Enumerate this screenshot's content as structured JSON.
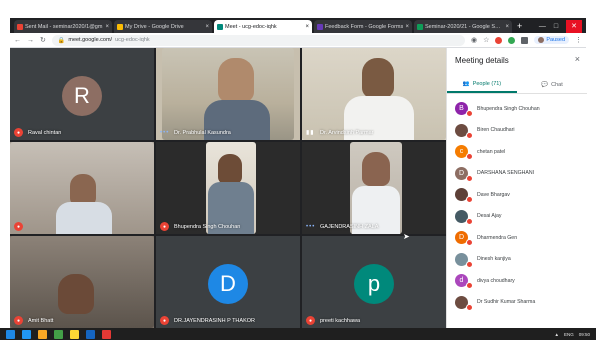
{
  "browser": {
    "tabs": [
      {
        "title": "Sent Mail - seminar2020/1@gm",
        "color": "#ea4335",
        "active": false
      },
      {
        "title": "My Drive - Google Drive",
        "color": "#fbbc04",
        "active": false
      },
      {
        "title": "Meet - ucg-edoc-iqhk",
        "color": "#00897b",
        "active": true
      },
      {
        "title": "Feedback Form - Google Forms",
        "color": "#673ab7",
        "active": false
      },
      {
        "title": "Seminar-2020/21 - Google Sheets",
        "color": "#0f9d58",
        "active": false
      }
    ],
    "new_tab": "+",
    "url_host": "meet.google.com/",
    "url_path": "ucg-edoc-iqhk",
    "profile_label": "Paused"
  },
  "meet": {
    "tiles": [
      {
        "name": "Raval chintan",
        "initial": "R",
        "avatar_color": "#8d6e63",
        "type": "avatar",
        "indicator": "badge"
      },
      {
        "name": "Dr. Prabhulal Kasundra",
        "type": "video",
        "indicator": "dots"
      },
      {
        "name": "Dr. Arvindsinh Parmar",
        "type": "video",
        "indicator": "mic"
      },
      {
        "name": "",
        "type": "video",
        "indicator": "badge"
      },
      {
        "name": "Bhupendra Singh Chouhan",
        "type": "video",
        "indicator": "badge"
      },
      {
        "name": "GAJENDRASINH ZALA",
        "type": "video",
        "indicator": "dots"
      },
      {
        "name": "Amit Bhatt",
        "type": "video",
        "indicator": "badge"
      },
      {
        "name": "DR.JAYENDRASINH P THAKOR",
        "initial": "D",
        "avatar_color": "#1e88e5",
        "type": "avatar",
        "indicator": "badge"
      },
      {
        "name": "preeti kachhawa",
        "initial": "p",
        "avatar_color": "#00897b",
        "type": "avatar",
        "indicator": "badge"
      }
    ]
  },
  "panel": {
    "title": "Meeting details",
    "close": "×",
    "tab_people": "People (71)",
    "tab_chat": "Chat",
    "participants": [
      {
        "name": "Bhupendra Singh Chouhan",
        "initial": "B",
        "color": "#8e24aa"
      },
      {
        "name": "Biren Chaudhari",
        "initial": "",
        "color": "#6d4c41"
      },
      {
        "name": "chetan patel",
        "initial": "c",
        "color": "#f57c00"
      },
      {
        "name": "DARSHANA SENGHANI",
        "initial": "D",
        "color": "#8d6e63"
      },
      {
        "name": "Dave Bhargav",
        "initial": "",
        "color": "#5d4037"
      },
      {
        "name": "Desai Ajay",
        "initial": "",
        "color": "#455a64"
      },
      {
        "name": "Dharmendra Gen",
        "initial": "D",
        "color": "#ef6c00"
      },
      {
        "name": "Dinesh kanjiya",
        "initial": "",
        "color": "#78909c"
      },
      {
        "name": "divya choudhary",
        "initial": "d",
        "color": "#ab47bc"
      },
      {
        "name": "Dr Sudhir Kumar Sharma",
        "initial": "",
        "color": "#6d4c41"
      }
    ]
  },
  "taskbar": {
    "lang": "ENG",
    "time": "09:50"
  }
}
